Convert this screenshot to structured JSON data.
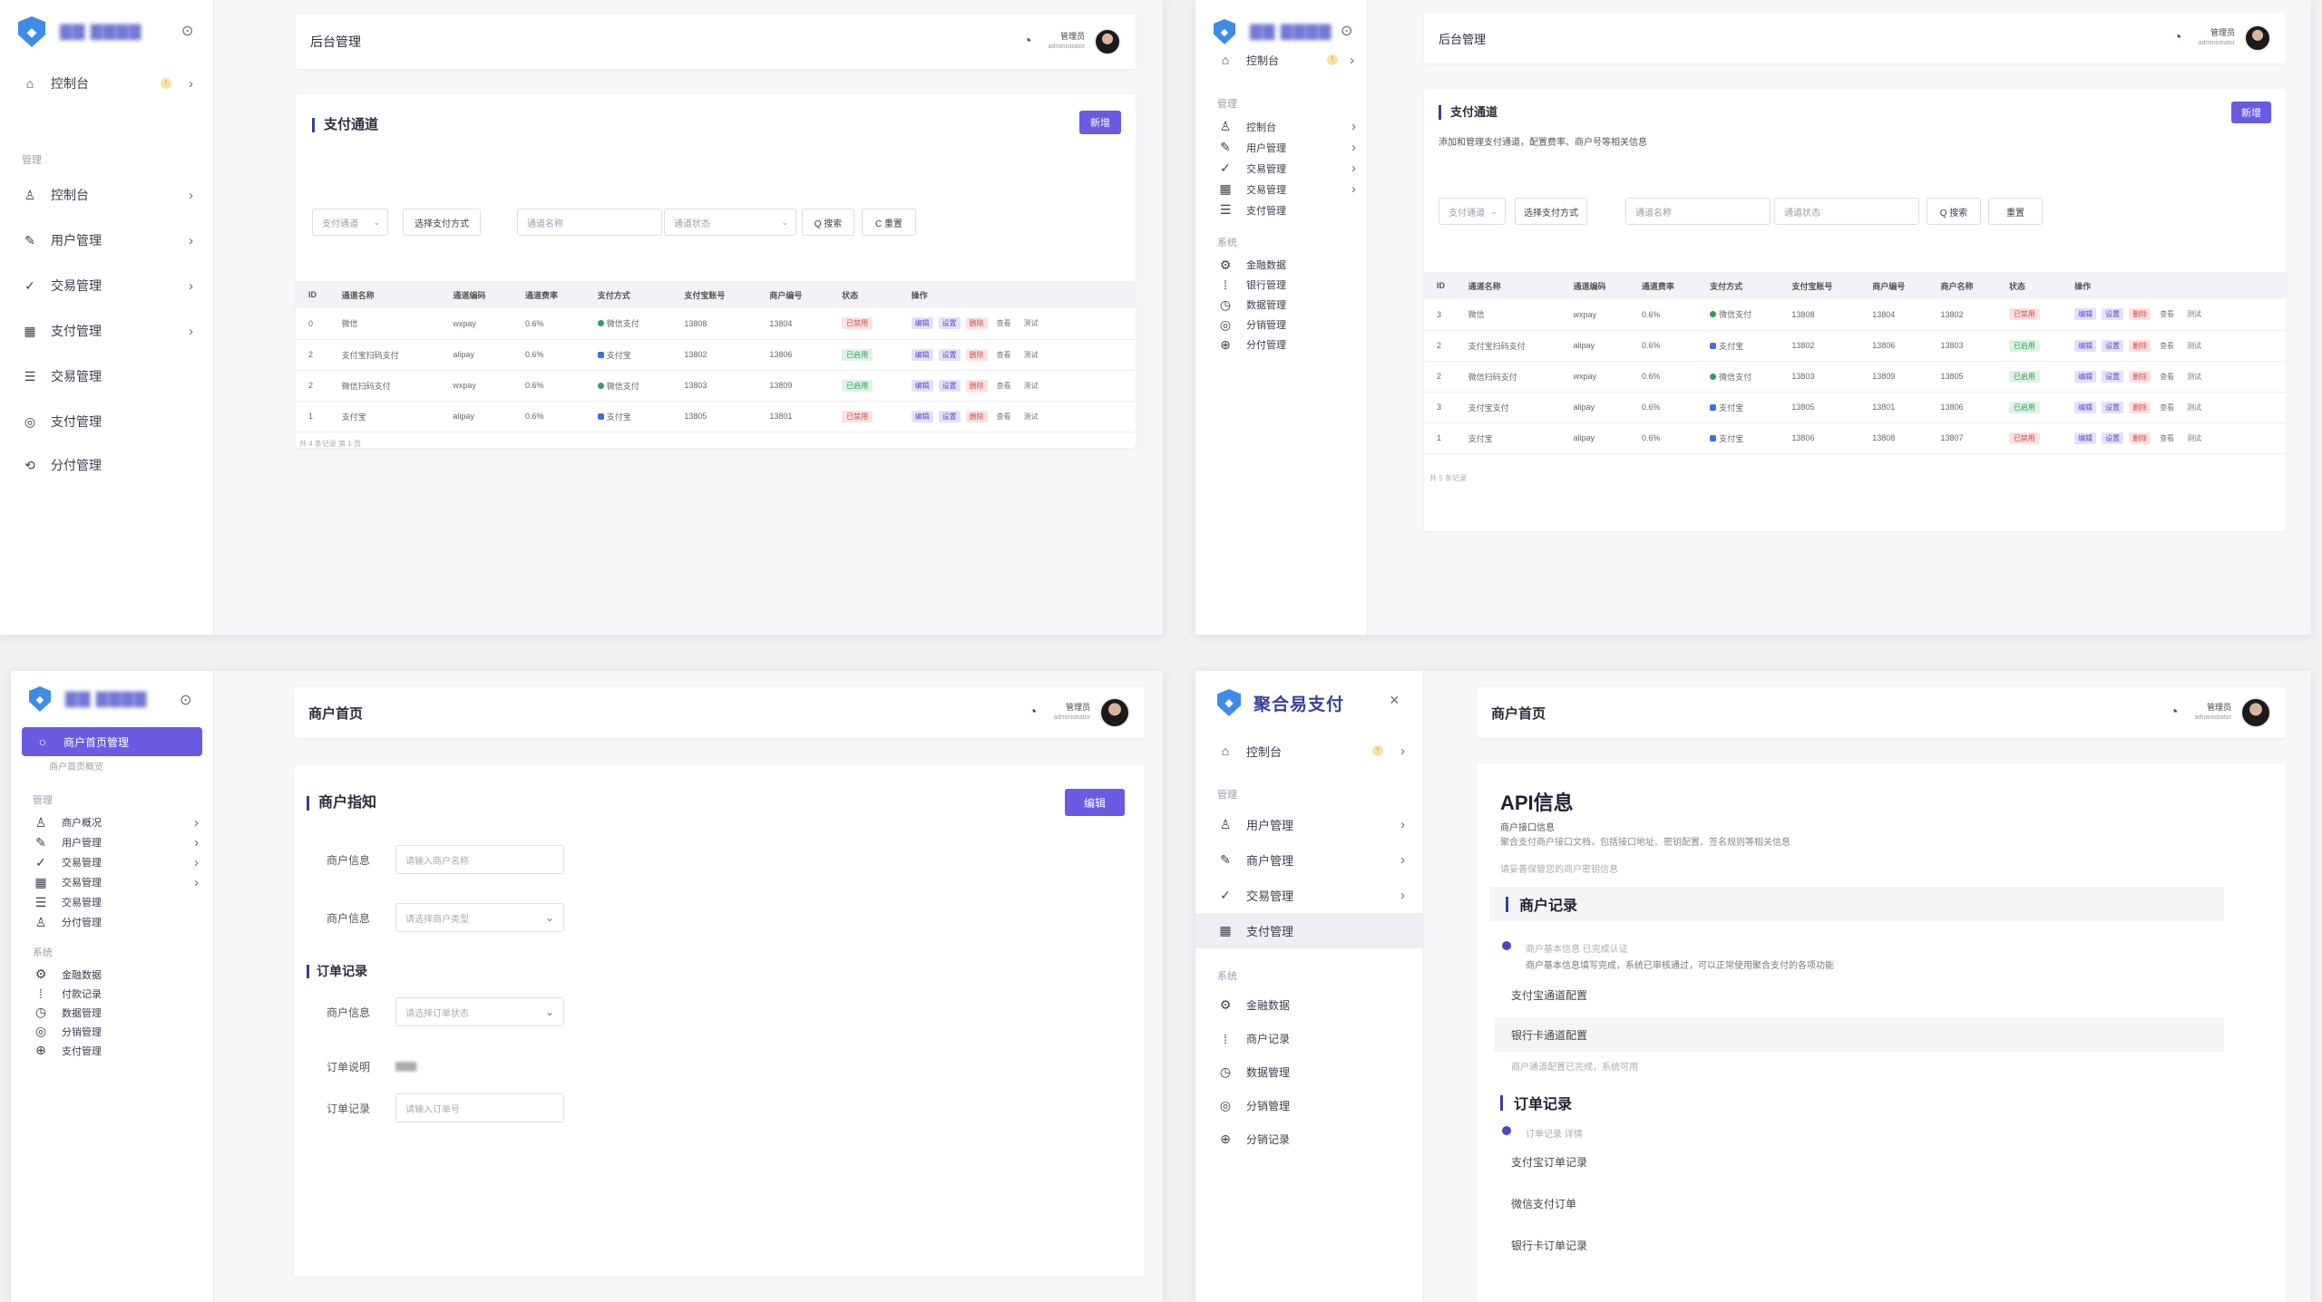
{
  "panels": {
    "p1": {
      "sidebar": {
        "brand": "▇▇ ▇▇▇▇",
        "items": [
          {
            "label": "控制台",
            "icon": "home-icon"
          },
          {
            "label": "控制台",
            "icon": "user-icon"
          },
          {
            "label": "用户管理",
            "icon": "user-edit-icon"
          },
          {
            "label": "交易管理",
            "icon": "check-circle-icon"
          },
          {
            "label": "支付管理",
            "icon": "grid-icon"
          },
          {
            "label": "交易管理",
            "icon": "list-icon"
          },
          {
            "label": "支付管理",
            "icon": "settings-icon"
          },
          {
            "label": "分付管理",
            "icon": "share-icon"
          }
        ],
        "section": "管理"
      },
      "header": {
        "title": "后台管理",
        "user": "管理员",
        "role": "administrator"
      },
      "card": {
        "title": "支付通道",
        "primary_btn": "新增",
        "filters": [
          "支付通道",
          "选择支付方式",
          "通道名称",
          "通道状态"
        ],
        "search_btn": "Q 搜索",
        "reset_btn": "C 重置"
      },
      "table": {
        "headers": [
          "ID",
          "通道名称",
          "通道编码",
          "通道费率",
          "支付方式",
          "支付宝账号",
          "商户编号",
          "状态",
          "操作"
        ],
        "rows": [
          {
            "id": "0",
            "name": "微信",
            "code": "wxpay",
            "rate": "0.6%",
            "method": "微信支付",
            "account": "13808",
            "mch": "13804",
            "status": "已禁用",
            "status_color": "red"
          },
          {
            "id": "2",
            "name": "支付宝扫码支付",
            "code": "alipay",
            "rate": "0.6%",
            "method": "支付宝",
            "account": "13802",
            "mch": "13806",
            "status": "已启用",
            "status_color": "green"
          },
          {
            "id": "2",
            "name": "微信扫码支付",
            "code": "wxpay",
            "rate": "0.6%",
            "method": "微信支付",
            "account": "13803",
            "mch": "13809",
            "status": "已启用",
            "status_color": "green"
          },
          {
            "id": "1",
            "name": "支付宝",
            "code": "alipay",
            "rate": "0.6%",
            "method": "支付宝",
            "account": "13805",
            "mch": "13801",
            "status": "已禁用",
            "status_color": "red"
          }
        ],
        "ops": [
          "编辑",
          "设置",
          "删除",
          "查看",
          "测试"
        ],
        "footer": "共 4 条记录 第 1 页"
      }
    },
    "p2": {
      "sidebar": {
        "brand": "▇▇ ▇▇▇▇",
        "top_item": "控制台",
        "section1": "管理",
        "items1": [
          "控制台",
          "用户管理",
          "交易管理",
          "交易管理",
          "支付管理"
        ],
        "section2": "系统",
        "items2": [
          "金融数据",
          "银行管理",
          "数据管理",
          "分销管理",
          "分付管理"
        ]
      },
      "header": {
        "title": "后台管理",
        "user": "管理员",
        "role": "administrator"
      },
      "card": {
        "title": "支付通道",
        "subtitle": "添加和管理支付通道，配置费率、商户号等相关信息",
        "primary_btn": "新增",
        "filters": [
          "支付通道",
          "选择支付方式",
          "通道名称",
          "通道状态"
        ],
        "search_btn": "Q 搜索",
        "reset_btn": "重置"
      },
      "table": {
        "headers": [
          "ID",
          "通道名称",
          "通道编码",
          "通道费率",
          "支付方式",
          "支付宝账号",
          "商户编号",
          "商户名称",
          "状态",
          "操作"
        ],
        "rows": [
          {
            "id": "3",
            "name": "微信",
            "code": "wxpay",
            "rate": "0.6%",
            "method": "微信支付",
            "account": "13808",
            "mch": "13804",
            "mname": "13802",
            "status": "已禁用",
            "status_color": "red"
          },
          {
            "id": "2",
            "name": "支付宝扫码支付",
            "code": "alipay",
            "rate": "0.6%",
            "method": "支付宝",
            "account": "13802",
            "mch": "13806",
            "mname": "13803",
            "status": "已启用",
            "status_color": "green"
          },
          {
            "id": "2",
            "name": "微信扫码支付",
            "code": "wxpay",
            "rate": "0.6%",
            "method": "微信支付",
            "account": "13803",
            "mch": "13809",
            "mname": "13805",
            "status": "已启用",
            "status_color": "green"
          },
          {
            "id": "3",
            "name": "支付宝支付",
            "code": "alipay",
            "rate": "0.6%",
            "method": "支付宝",
            "account": "13805",
            "mch": "13801",
            "mname": "13806",
            "status": "已启用",
            "status_color": "green"
          },
          {
            "id": "1",
            "name": "支付宝",
            "code": "alipay",
            "rate": "0.6%",
            "method": "支付宝",
            "account": "13806",
            "mch": "13808",
            "mname": "13807",
            "status": "已禁用",
            "status_color": "red"
          }
        ],
        "ops": [
          "编辑",
          "设置",
          "删除",
          "查看",
          "测试"
        ],
        "footer": "共 5 条记录"
      }
    },
    "p3": {
      "sidebar": {
        "brand": "▇▇ ▇▇▇▇",
        "active_item": "商户首页管理",
        "sub_item": "商户首页概览",
        "section1": "管理",
        "items1": [
          "商户概况",
          "用户管理",
          "交易管理",
          "交易管理",
          "交易管理",
          "分付管理"
        ],
        "section2": "系统",
        "items2": [
          "金融数据",
          "付款记录",
          "数据管理",
          "分销管理",
          "支付管理"
        ]
      },
      "header": {
        "title": "商户首页",
        "user": "管理员",
        "role": "administrator"
      },
      "card": {
        "title": "商户指知",
        "primary_btn": "编辑",
        "field1_label": "商户信息",
        "field1_ph": "请输入商户名称",
        "field2_label": "商户信息",
        "field2_ph": "请选择商户类型",
        "section2": "订单记录",
        "field3_label": "商户信息",
        "field3_ph": "请选择订单状态",
        "field4_label": "订单说明",
        "field4_value": "▇▇▇ ·",
        "field5_label": "订单记录",
        "field5_ph": "请输入订单号"
      }
    },
    "p4": {
      "sidebar": {
        "brand": "聚合易支付",
        "top_item": "控制台",
        "section1": "管理",
        "items1": [
          "用户管理",
          "商户管理",
          "交易管理",
          "支付管理"
        ],
        "section2": "系统",
        "items2": [
          "金融数据",
          "商户记录",
          "数据管理",
          "分销管理",
          "分销记录"
        ]
      },
      "header": {
        "title": "商户首页",
        "user": "管理员",
        "role": "administrator"
      },
      "card": {
        "api_title": "API信息",
        "api_sub": "商户接口信息",
        "api_desc": "聚合支付商户接口文档，包括接口地址、密钥配置、签名规则等相关信息",
        "api_note": "请妥善保管您的商户密钥信息",
        "sec1": "商户记录",
        "tl1_meta": "商户基本信息 已完成认证",
        "tl1_desc": "商户基本信息填写完成，系统已审核通过，可以正常使用聚合支付的各项功能",
        "rec1": "支付宝通道配置",
        "rec2": "银行卡通道配置",
        "rec_note": "商户通道配置已完成，系统可用",
        "sec2": "订单记录",
        "tl2_meta": "订单记录 详情",
        "rec3": "支付宝订单记录",
        "rec4": "微信支付订单",
        "rec5": "银行卡订单记录"
      }
    }
  },
  "colors": {
    "accent": "#6a5be2",
    "brand_blue": "#3f8ce8",
    "title_bar": "#3a3f9a"
  }
}
